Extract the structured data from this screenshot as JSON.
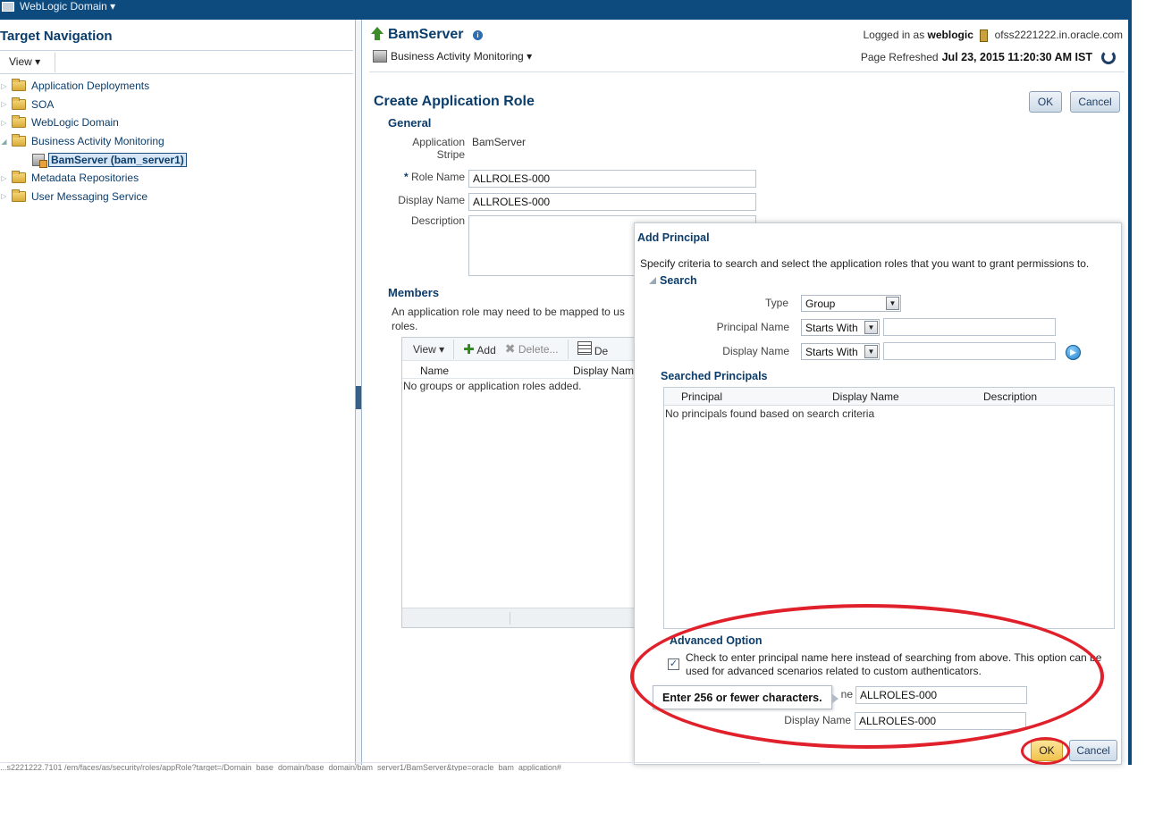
{
  "topbar": {
    "domain_menu": "WebLogic Domain ▾"
  },
  "nav": {
    "title": "Target Navigation",
    "view_menu": "View ▾",
    "items": [
      {
        "label": "Application Deployments"
      },
      {
        "label": "SOA"
      },
      {
        "label": "WebLogic Domain"
      },
      {
        "label": "Business Activity Monitoring"
      },
      {
        "label": "BamServer (bam_server1)"
      },
      {
        "label": "Metadata Repositories"
      },
      {
        "label": "User Messaging Service"
      }
    ]
  },
  "header": {
    "server_name": "BamServer",
    "bam_menu": "Business Activity Monitoring ▾",
    "logged_in_prefix": "Logged in as",
    "user": "weblogic",
    "host": "ofss2221222.in.oracle.com",
    "refreshed_prefix": "Page Refreshed",
    "refreshed_time": "Jul 23, 2015 11:20:30 AM IST"
  },
  "form": {
    "title": "Create Application Role",
    "ok_label": "OK",
    "cancel_label": "Cancel",
    "general_heading": "General",
    "stripe_label_1": "Application",
    "stripe_label_2": "Stripe",
    "stripe_value": "BamServer",
    "role_name_label": "Role Name",
    "role_name_value": "ALLROLES-000",
    "display_name_label": "Display Name",
    "display_name_value": "ALLROLES-000",
    "description_label": "Description",
    "members_heading": "Members",
    "members_desc": "An application role may need to be mapped to us roles.",
    "toolbar_view": "View ▾",
    "toolbar_add": "Add",
    "toolbar_delete": "Delete...",
    "toolbar_de": "De",
    "col_name": "Name",
    "col_display_name": "Display Name",
    "empty_text": "No groups or application roles added."
  },
  "dialog": {
    "title": "Add Principal",
    "instructions": "Specify criteria to search and select the application roles that you want to grant permissions to.",
    "search_heading": "Search",
    "type_label": "Type",
    "type_value": "Group",
    "principal_name_label": "Principal Name",
    "principal_name_operator": "Starts With",
    "display_name_label": "Display Name",
    "display_name_operator": "Starts With",
    "searched_heading": "Searched Principals",
    "col_principal": "Principal",
    "col_display_name": "Display Name",
    "col_description": "Description",
    "empty_text": "No principals found based on search criteria",
    "advanced_heading": "Advanced Option",
    "advanced_text": "Check to enter principal name here instead of searching from above. This option can be used for advanced scenarios related to custom authenticators.",
    "tooltip": "Enter 256 or fewer characters.",
    "adv_principal_label_tail": "ne",
    "adv_principal_value": "ALLROLES-000",
    "adv_display_label": "Display Name",
    "adv_display_value": "ALLROLES-000",
    "ok_label": "OK",
    "cancel_label": "Cancel"
  },
  "statusbar": {
    "text": "...s2221222.7101 /em/faces/as/security/roles/appRole?target=/Domain_base_domain/base_domain/bam_server1/BamServer&type=oracle_bam_application#"
  },
  "colors": {
    "header_blue": "#0d4b7e",
    "title_blue": "#0b3d6b",
    "highlight_red": "#e0202a",
    "ok_yellow": "#f6d46b"
  }
}
